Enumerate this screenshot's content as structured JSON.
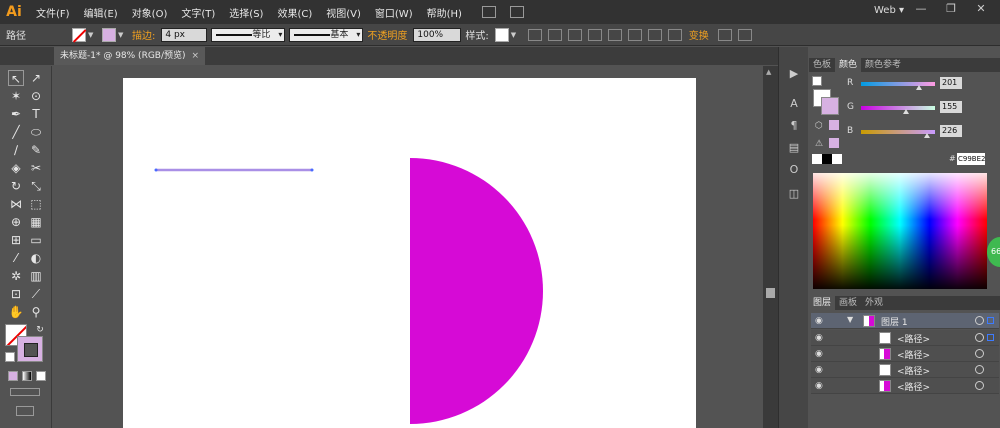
{
  "app": {
    "logo": "Ai",
    "menus": [
      "文件(F)",
      "编辑(E)",
      "对象(O)",
      "文字(T)",
      "选择(S)",
      "效果(C)",
      "视图(V)",
      "窗口(W)",
      "帮助(H)"
    ],
    "workspace": "Web ▾",
    "window_buttons": [
      "—",
      "❐",
      "✕"
    ]
  },
  "control_bar": {
    "selection_type": "路径",
    "stroke_label": "描边:",
    "stroke_weight": "4 px",
    "variable_width": "等比",
    "brush": "基本",
    "opacity_label": "不透明度",
    "opacity_value": "100%",
    "style_label": "样式:",
    "transform_label": "变换"
  },
  "document": {
    "tab_title": "未标题-1* @ 98% (RGB/预览)",
    "close": "×"
  },
  "color_panel": {
    "tabs": [
      "色板",
      "颜色",
      "颜色参考"
    ],
    "active_tab": "颜色",
    "channels": [
      {
        "label": "R",
        "value": "201",
        "fraction": 0.79
      },
      {
        "label": "G",
        "value": "155",
        "fraction": 0.61
      },
      {
        "label": "B",
        "value": "226",
        "fraction": 0.89
      }
    ],
    "hex_prefix": "#",
    "hex": "C99BE2",
    "badge": "66"
  },
  "layers_panel": {
    "tabs": [
      "图层",
      "画板",
      "外观"
    ],
    "active_tab": "图层",
    "rows": [
      {
        "name": "图层 1",
        "kind": "layer"
      },
      {
        "name": "<路径>",
        "kind": "path"
      },
      {
        "name": "<路径>",
        "kind": "path"
      },
      {
        "name": "<路径>",
        "kind": "path"
      },
      {
        "name": "<路径>",
        "kind": "path"
      }
    ]
  },
  "canvas_art": {
    "line_color": "#a98fe6",
    "half_circle_color": "#d60ad6"
  }
}
